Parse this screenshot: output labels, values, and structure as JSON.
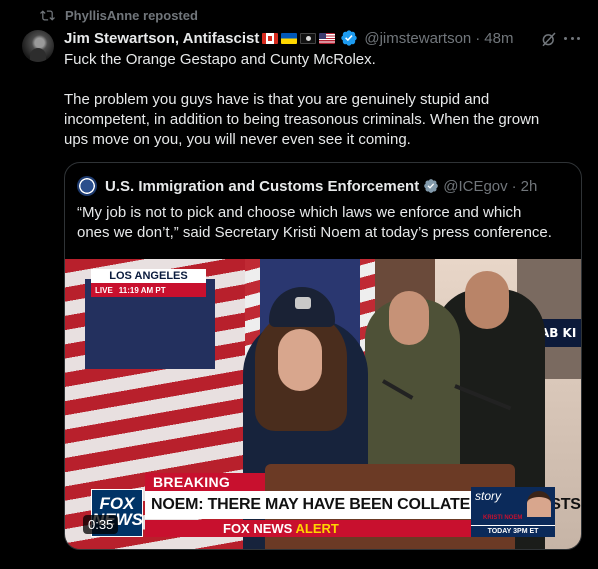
{
  "repost": {
    "label": "PhyllisAnne reposted",
    "icon": "repost-icon"
  },
  "post": {
    "author_name": "Jim Stewartson, Antifascist",
    "flags": [
      "canada-flag",
      "ukraine-flag",
      "pirate-flag",
      "us-flag"
    ],
    "handle": "@jimstewartson",
    "separator": "·",
    "time": "48m",
    "line1": "Fuck the Orange Gestapo and Cunty McRolex.",
    "para2_line1": "The problem you guys have is that you are genuinely stupid and",
    "para2_line2": "incompetent, in addition to being treasonous criminals. When the grown",
    "para2_line3": "ups move on you, you will never even see it coming."
  },
  "quote": {
    "author_name": "U.S. Immigration and Customs Enforcement",
    "handle": "@ICEgov",
    "separator": "·",
    "time": "2h",
    "text_line1": "“My job is not to pick and choose which laws we enforce and which",
    "text_line2": "ones we don’t,” said Secretary Kristi Noem at today’s press conference."
  },
  "video": {
    "location": "LOS ANGELES",
    "live": "LIVE",
    "live_time": "11:19 AM PT",
    "breaking": "BREAKING NEWS",
    "network_logo_line1": "FOX",
    "network_logo_line2": "NEWS",
    "headline": "NOEM: THERE MAY HAVE BEEN COLLATERAL ARRESTS",
    "alert_prefix": "FOX NEWS",
    "alert_word": "ALERT",
    "story_label": "story",
    "story_name": "KRISTI NOEM",
    "story_time": "TODAY 3PM ET",
    "background_sign": "MAB KI",
    "duration": "0:35"
  },
  "colors": {
    "background": "#000000",
    "text": "#e7e9ea",
    "muted": "#71767b",
    "verified": "#1d9bf0",
    "fox_red": "#c8102e"
  }
}
